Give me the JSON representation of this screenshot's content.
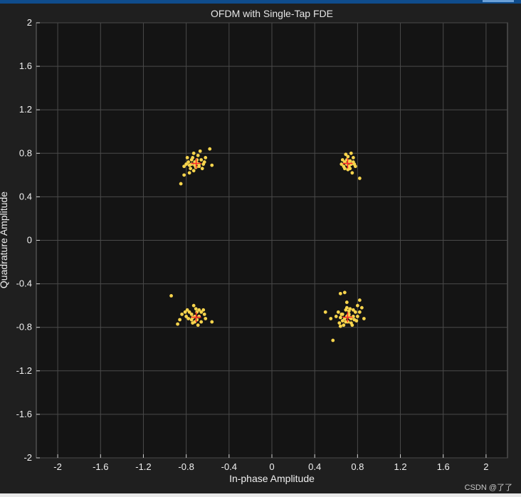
{
  "chart_data": {
    "type": "scatter",
    "title": "OFDM with Single-Tap FDE",
    "xlabel": "In-phase Amplitude",
    "ylabel": "Quadrature Amplitude",
    "xlim": [
      -2.2,
      2.2
    ],
    "ylim": [
      -2,
      2
    ],
    "xticks": [
      "-2",
      "-1.6",
      "-1.2",
      "-0.8",
      "-0.4",
      "0",
      "0.4",
      "0.8",
      "1.2",
      "1.6",
      "2"
    ],
    "yticks": [
      "2",
      "1.6",
      "1.2",
      "0.8",
      "0.4",
      "0",
      "-0.4",
      "-0.8",
      "-1.2",
      "-1.6",
      "-2"
    ],
    "grid": true,
    "background": "#141414",
    "grid_color": "#4a4a4a",
    "series": [
      {
        "marker": "dot",
        "color": "#f7d44c",
        "points": [
          [
            -0.72,
            0.72
          ],
          [
            -0.75,
            0.7
          ],
          [
            -0.7,
            0.74
          ],
          [
            -0.68,
            0.7
          ],
          [
            -0.78,
            0.72
          ],
          [
            -0.74,
            0.76
          ],
          [
            -0.66,
            0.74
          ],
          [
            -0.71,
            0.67
          ],
          [
            -0.76,
            0.66
          ],
          [
            -0.69,
            0.78
          ],
          [
            -0.8,
            0.7
          ],
          [
            -0.64,
            0.7
          ],
          [
            -0.73,
            0.8
          ],
          [
            -0.77,
            0.62
          ],
          [
            -0.82,
            0.68
          ],
          [
            -0.62,
            0.76
          ],
          [
            -0.67,
            0.82
          ],
          [
            -0.58,
            0.84
          ],
          [
            -0.56,
            0.69
          ],
          [
            -0.85,
            0.52
          ],
          [
            -0.82,
            0.6
          ],
          [
            -0.65,
            0.66
          ],
          [
            -0.73,
            0.64
          ],
          [
            -0.79,
            0.76
          ],
          [
            -0.7,
            0.71
          ],
          [
            -0.75,
            0.74
          ],
          [
            -0.68,
            0.68
          ],
          [
            -0.72,
            0.69
          ],
          [
            -0.63,
            0.72
          ],
          [
            -0.77,
            0.69
          ],
          [
            0.72,
            0.72
          ],
          [
            0.7,
            0.74
          ],
          [
            0.74,
            0.7
          ],
          [
            0.68,
            0.72
          ],
          [
            0.76,
            0.72
          ],
          [
            0.71,
            0.77
          ],
          [
            0.73,
            0.66
          ],
          [
            0.67,
            0.68
          ],
          [
            0.78,
            0.68
          ],
          [
            0.69,
            0.79
          ],
          [
            0.76,
            0.76
          ],
          [
            0.66,
            0.74
          ],
          [
            0.74,
            0.8
          ],
          [
            0.75,
            0.62
          ],
          [
            0.71,
            0.65
          ],
          [
            0.82,
            0.57
          ],
          [
            0.7,
            0.7
          ],
          [
            0.73,
            0.73
          ],
          [
            0.68,
            0.66
          ],
          [
            0.77,
            0.7
          ],
          [
            0.65,
            0.7
          ],
          [
            0.72,
            0.68
          ],
          [
            -0.72,
            -0.7
          ],
          [
            -0.75,
            -0.68
          ],
          [
            -0.7,
            -0.73
          ],
          [
            -0.68,
            -0.7
          ],
          [
            -0.78,
            -0.72
          ],
          [
            -0.74,
            -0.76
          ],
          [
            -0.66,
            -0.66
          ],
          [
            -0.71,
            -0.63
          ],
          [
            -0.79,
            -0.64
          ],
          [
            -0.69,
            -0.78
          ],
          [
            -0.8,
            -0.7
          ],
          [
            -0.63,
            -0.68
          ],
          [
            -0.73,
            -0.6
          ],
          [
            -0.77,
            -0.66
          ],
          [
            -0.62,
            -0.72
          ],
          [
            -0.66,
            -0.75
          ],
          [
            -0.84,
            -0.68
          ],
          [
            -0.86,
            -0.73
          ],
          [
            -0.94,
            -0.51
          ],
          [
            -0.88,
            -0.77
          ],
          [
            -0.56,
            -0.75
          ],
          [
            -0.7,
            -0.66
          ],
          [
            -0.75,
            -0.73
          ],
          [
            -0.68,
            -0.64
          ],
          [
            -0.72,
            -0.75
          ],
          [
            -0.81,
            -0.66
          ],
          [
            -0.64,
            -0.64
          ],
          [
            -0.74,
            -0.71
          ],
          [
            0.7,
            -0.7
          ],
          [
            0.72,
            -0.68
          ],
          [
            0.68,
            -0.72
          ],
          [
            0.74,
            -0.72
          ],
          [
            0.66,
            -0.68
          ],
          [
            0.76,
            -0.7
          ],
          [
            0.71,
            -0.75
          ],
          [
            0.69,
            -0.64
          ],
          [
            0.78,
            -0.66
          ],
          [
            0.67,
            -0.78
          ],
          [
            0.64,
            -0.71
          ],
          [
            0.73,
            -0.63
          ],
          [
            0.75,
            -0.78
          ],
          [
            0.62,
            -0.66
          ],
          [
            0.8,
            -0.7
          ],
          [
            0.82,
            -0.66
          ],
          [
            0.8,
            -0.6
          ],
          [
            0.82,
            -0.55
          ],
          [
            0.84,
            -0.62
          ],
          [
            0.86,
            -0.72
          ],
          [
            0.7,
            -0.57
          ],
          [
            0.68,
            -0.48
          ],
          [
            0.64,
            -0.49
          ],
          [
            0.6,
            -0.7
          ],
          [
            0.55,
            -0.72
          ],
          [
            0.5,
            -0.66
          ],
          [
            0.57,
            -0.92
          ],
          [
            0.64,
            -0.79
          ],
          [
            0.69,
            -0.75
          ],
          [
            0.74,
            -0.76
          ],
          [
            0.72,
            -0.65
          ],
          [
            0.66,
            -0.74
          ],
          [
            0.77,
            -0.73
          ],
          [
            0.7,
            -0.62
          ],
          [
            0.65,
            -0.68
          ],
          [
            0.73,
            -0.71
          ],
          [
            0.71,
            -0.69
          ],
          [
            0.79,
            -0.74
          ],
          [
            0.63,
            -0.76
          ],
          [
            0.76,
            -0.64
          ]
        ]
      },
      {
        "marker": "plus",
        "color": "#ff2a2a",
        "points": [
          [
            -0.707,
            0.707
          ],
          [
            0.707,
            0.707
          ],
          [
            -0.707,
            -0.707
          ],
          [
            0.707,
            -0.707
          ]
        ]
      }
    ]
  },
  "watermark": "CSDN @了了",
  "colors": {
    "window_background": "#1f1f1f",
    "title_bar": "#0f4c8c",
    "text": "#f0f0f0"
  }
}
